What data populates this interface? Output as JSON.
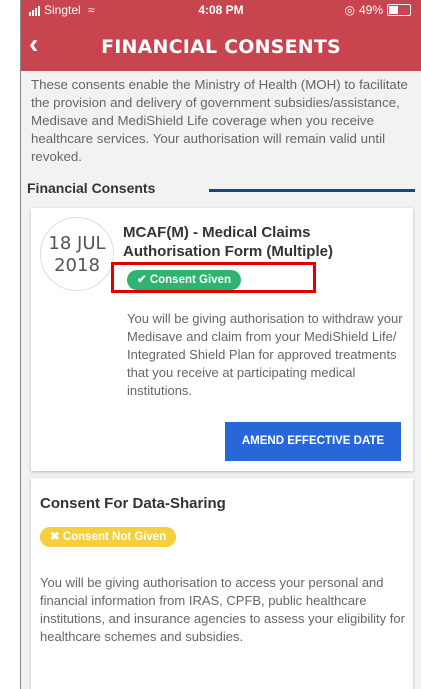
{
  "status_bar": {
    "carrier": "Singtel",
    "time": "4:08 PM",
    "battery": "49%",
    "battery_level": 0.49
  },
  "header": {
    "back_glyph": "‹",
    "back_icon": "chevron-left-icon",
    "title": "FINANCIAL CONSENTS"
  },
  "intro_text": "These consents enable the Ministry of Health (MOH) to facilitate the provision and delivery of government subsidies/assistance, Medisave and MediShield Life coverage when you receive healthcare services. Your authorisation will remain valid until revoked.",
  "section_title": "Financial Consents",
  "consents": [
    {
      "date_day_month": "18 JUL",
      "date_year": "2018",
      "title": "MCAF(M) - Medical Claims Authorisation Form (Multiple)",
      "status": "✔ Consent Given",
      "status_color": "#2fb371",
      "description": "You will be giving authorisation to withdraw your Medisave and claim from your MediShield Life/ Integrated Shield Plan for approved treatments that you receive at participating medical institutions.",
      "action_label": "AMEND EFFECTIVE DATE"
    },
    {
      "title": "Consent For Data-Sharing",
      "status": "✖ Consent Not Given",
      "status_color": "#f5cf3c",
      "description": "You will be giving authorisation to access your personal and financial information from IRAS, CPFB, public healthcare institutions, and insurance agencies to assess your eligibility for healthcare schemes and subsidies."
    }
  ],
  "colors": {
    "header_bg": "#c8454f",
    "accent_blue": "#2767d8",
    "highlight_box": "#e00000"
  }
}
